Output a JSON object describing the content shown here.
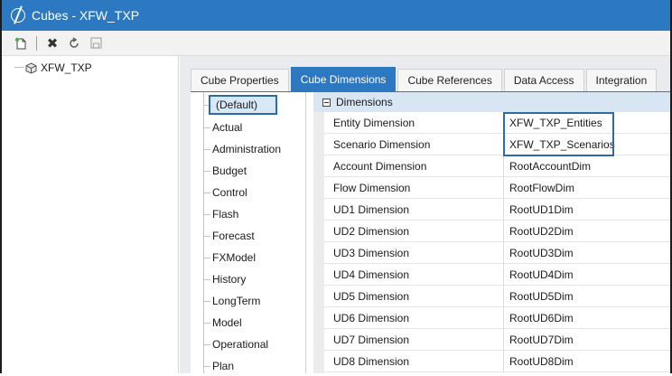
{
  "window": {
    "title": "Cubes - XFW_TXP"
  },
  "toolbar": {
    "icons": [
      "new-icon",
      "delete-icon",
      "refresh-icon",
      "save-icon"
    ]
  },
  "tree": {
    "root_label": "XFW_TXP"
  },
  "tabs": [
    {
      "label": "Cube Properties",
      "active": false
    },
    {
      "label": "Cube Dimensions",
      "active": true
    },
    {
      "label": "Cube References",
      "active": false
    },
    {
      "label": "Data Access",
      "active": false
    },
    {
      "label": "Integration",
      "active": false
    }
  ],
  "scenarios": [
    "(Default)",
    "Actual",
    "Administration",
    "Budget",
    "Control",
    "Flash",
    "Forecast",
    "FXModel",
    "History",
    "LongTerm",
    "Model",
    "Operational",
    "Plan"
  ],
  "selected_scenario": "(Default)",
  "grid": {
    "group_label": "Dimensions",
    "rows": [
      {
        "name": "Entity Dimension",
        "value": "XFW_TXP_Entities"
      },
      {
        "name": "Scenario Dimension",
        "value": "XFW_TXP_Scenarios"
      },
      {
        "name": "Account Dimension",
        "value": "RootAccountDim"
      },
      {
        "name": "Flow Dimension",
        "value": "RootFlowDim"
      },
      {
        "name": "UD1 Dimension",
        "value": "RootUD1Dim"
      },
      {
        "name": "UD2 Dimension",
        "value": "RootUD2Dim"
      },
      {
        "name": "UD3 Dimension",
        "value": "RootUD3Dim"
      },
      {
        "name": "UD4 Dimension",
        "value": "RootUD4Dim"
      },
      {
        "name": "UD5 Dimension",
        "value": "RootUD5Dim"
      },
      {
        "name": "UD6 Dimension",
        "value": "RootUD6Dim"
      },
      {
        "name": "UD7 Dimension",
        "value": "RootUD7Dim"
      },
      {
        "name": "UD8 Dimension",
        "value": "RootUD8Dim"
      }
    ]
  },
  "colors": {
    "accent": "#2d79c1",
    "header": "#d8e6f3",
    "highlight": "#2e6aa6"
  }
}
